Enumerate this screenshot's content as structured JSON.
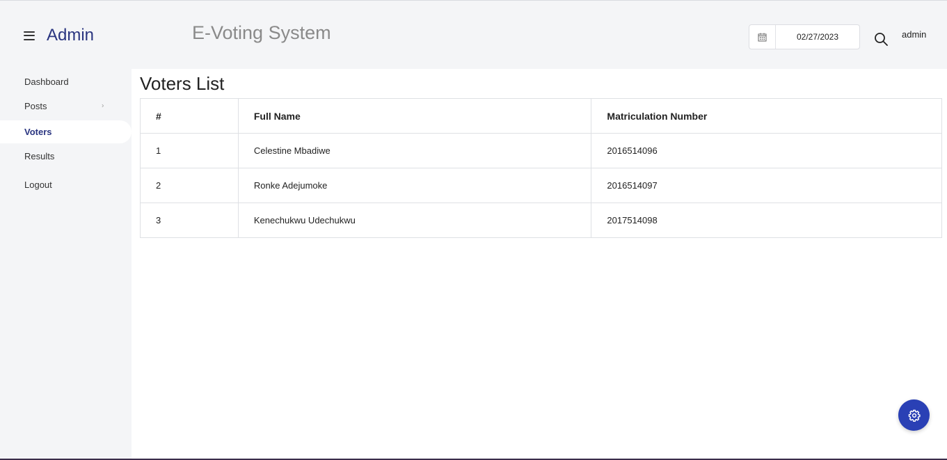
{
  "header": {
    "brand": "Admin",
    "app_title": "E-Voting System",
    "date_value": "02/27/2023",
    "user": "admin"
  },
  "sidebar": {
    "items": [
      {
        "label": "Dashboard"
      },
      {
        "label": "Posts"
      },
      {
        "label": "Voters"
      },
      {
        "label": "Results"
      },
      {
        "label": "Logout"
      }
    ]
  },
  "main": {
    "title": "Voters List",
    "table": {
      "columns": [
        "#",
        "Full Name",
        "Matriculation Number"
      ],
      "rows": [
        [
          "1",
          "Celestine Mbadiwe",
          "2016514096"
        ],
        [
          "2",
          "Ronke Adejumoke",
          "2016514097"
        ],
        [
          "3",
          "Kenechukwu Udechukwu",
          "2017514098"
        ]
      ]
    }
  },
  "colors": {
    "accent": "#2a3580",
    "fab": "#2a40b5",
    "sidebar_bg": "#f4f5f7"
  },
  "icons": [
    "hamburger-icon",
    "calendar-icon",
    "search-icon",
    "chevron-right-icon",
    "gear-icon"
  ]
}
